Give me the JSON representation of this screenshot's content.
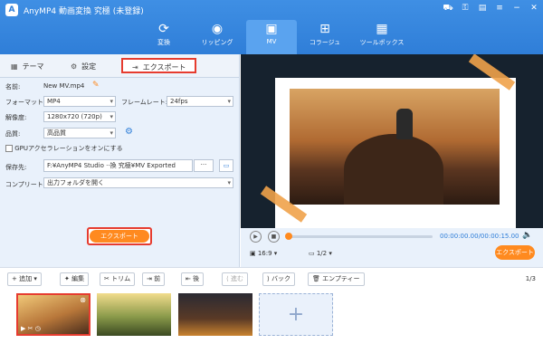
{
  "app": {
    "title": "AnyMP4 動画変換 究極 (未登録)",
    "logo": "A"
  },
  "window_controls": [
    "cart-icon",
    "key-icon",
    "register-icon",
    "menu-icon",
    "minimize-icon",
    "close-icon"
  ],
  "nav": {
    "tabs": [
      {
        "label": "変換",
        "icon": "convert-icon"
      },
      {
        "label": "リッピング",
        "icon": "ripper-icon"
      },
      {
        "label": "MV",
        "icon": "mv-icon",
        "active": true
      },
      {
        "label": "コラージュ",
        "icon": "collage-icon"
      },
      {
        "label": "ツールボックス",
        "icon": "toolbox-icon"
      }
    ]
  },
  "subtabs": {
    "theme": "テーマ",
    "settings": "設定",
    "export": "エクスポート"
  },
  "form": {
    "name_label": "名前:",
    "name_value": "New MV.mp4",
    "format_label": "フォーマット:",
    "format_value": "MP4",
    "framerate_label": "フレームレート:",
    "framerate_value": "24fps",
    "resolution_label": "解像度:",
    "resolution_value": "1280x720 (720p)",
    "quality_label": "品質:",
    "quality_value": "高品質",
    "gpu_label": "GPUアクセラレーションをオンにする",
    "save_label": "保存先:",
    "save_value": "F:¥AnyMP4 Studio ··換 究極¥MV Exported",
    "browse": "···",
    "complete_label": "コンプリート:",
    "complete_value": "出力フォルダを開く"
  },
  "export_button": "エクスポート",
  "player": {
    "time": "00:00:00.00/00:00:15.00",
    "aspect": "16:9",
    "page": "1/2",
    "export_label": "エクスポート"
  },
  "toolbar": {
    "add": "追加",
    "edit": "編集",
    "trim": "トリム",
    "forward": "前",
    "backward": "後",
    "ahead": "進む",
    "back": "バック",
    "empty": "エンプティー",
    "page": "1/3"
  },
  "colors": {
    "accent": "#ff8a1f",
    "brand": "#2f7ed8",
    "highlight": "#e63c2f"
  }
}
